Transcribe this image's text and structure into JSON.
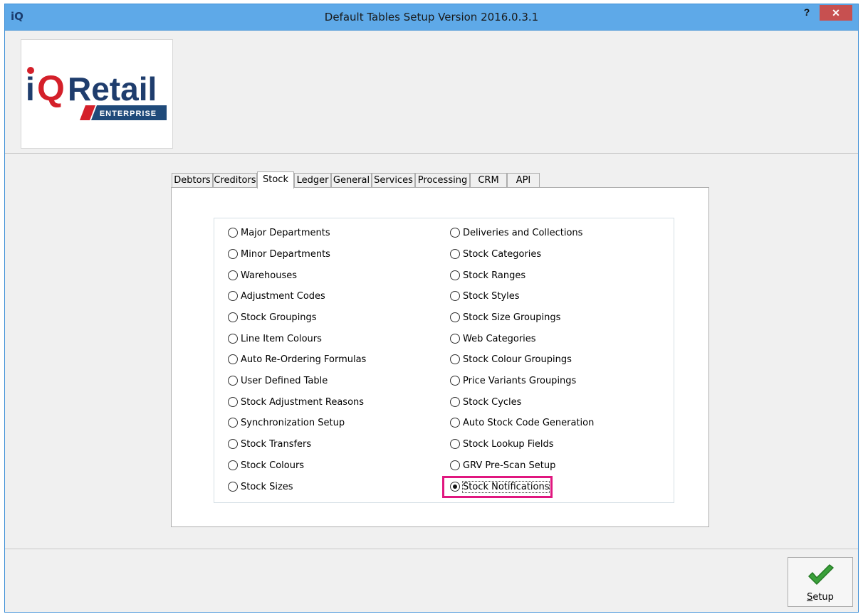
{
  "window": {
    "app_icon": "iQ",
    "title": "Default Tables Setup Version 2016.0.3.1",
    "help_label": "?",
    "close_label": "✕"
  },
  "logo": {
    "brand_i": "i",
    "brand_q": "Q",
    "brand_retail": "Retail",
    "edition": "ENTERPRISE"
  },
  "tabs": [
    {
      "label": "Debtors"
    },
    {
      "label": "Creditors"
    },
    {
      "label": "Stock"
    },
    {
      "label": "Ledger"
    },
    {
      "label": "General"
    },
    {
      "label": "Services"
    },
    {
      "label": "Processing"
    },
    {
      "label": "CRM"
    },
    {
      "label": "API"
    }
  ],
  "active_tab": "Stock",
  "left_options": [
    {
      "label": "Major Departments"
    },
    {
      "label": "Minor Departments"
    },
    {
      "label": "Warehouses"
    },
    {
      "label": "Adjustment Codes"
    },
    {
      "label": "Stock Groupings"
    },
    {
      "label": "Line Item Colours"
    },
    {
      "label": "Auto Re-Ordering Formulas"
    },
    {
      "label": "User Defined Table"
    },
    {
      "label": "Stock Adjustment Reasons"
    },
    {
      "label": "Synchronization Setup"
    },
    {
      "label": "Stock Transfers"
    },
    {
      "label": "Stock Colours"
    },
    {
      "label": "Stock Sizes"
    }
  ],
  "right_options": [
    {
      "label": "Deliveries and Collections"
    },
    {
      "label": "Stock Categories"
    },
    {
      "label": "Stock Ranges"
    },
    {
      "label": "Stock Styles"
    },
    {
      "label": "Stock Size Groupings"
    },
    {
      "label": "Web Categories"
    },
    {
      "label": "Stock Colour Groupings"
    },
    {
      "label": "Price Variants Groupings"
    },
    {
      "label": "Stock Cycles"
    },
    {
      "label": "Auto Stock Code Generation"
    },
    {
      "label": "Stock Lookup Fields"
    },
    {
      "label": "GRV Pre-Scan Setup"
    },
    {
      "label": "Stock Notifications"
    }
  ],
  "selected_option": "Stock Notifications",
  "footer": {
    "setup_label": "Setup"
  },
  "colors": {
    "titlebar": "#5ea9e8",
    "close_button": "#c75050",
    "highlight": "#e0177f",
    "check_icon": "#3aa03a"
  }
}
